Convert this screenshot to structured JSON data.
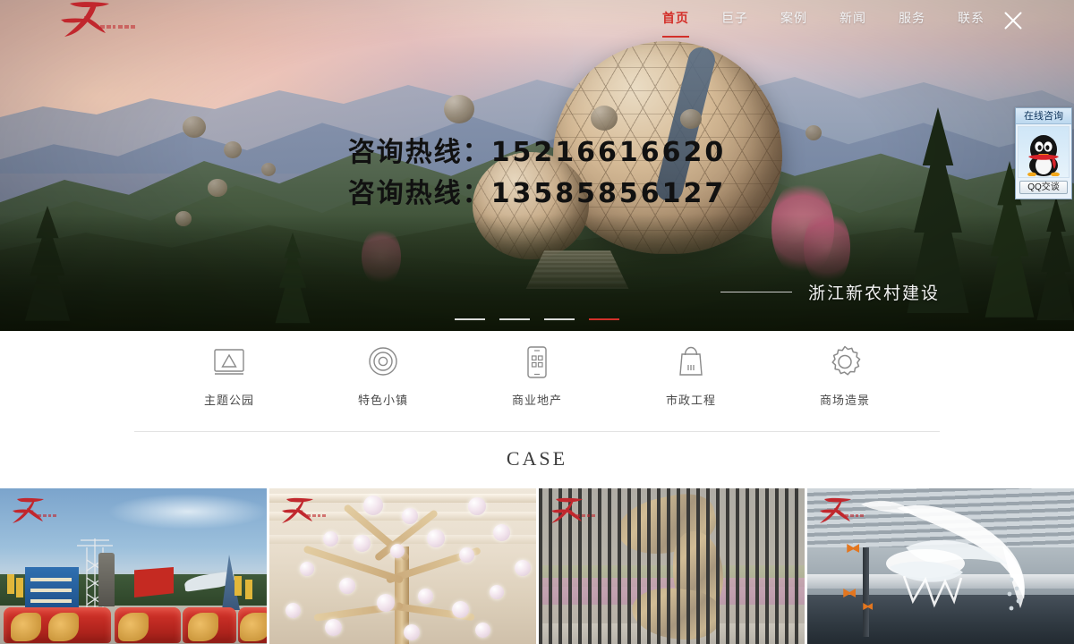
{
  "site": {
    "logo_alt": "巨子景观",
    "logo_color": "#c1272d"
  },
  "header": {
    "nav": [
      {
        "label": "首页",
        "active": true
      },
      {
        "label": "巨子",
        "active": false
      },
      {
        "label": "案例",
        "active": false
      },
      {
        "label": "新闻",
        "active": false
      },
      {
        "label": "服务",
        "active": false
      },
      {
        "label": "联系",
        "active": false
      }
    ],
    "close_icon": "close-icon",
    "accent_color": "#d3302a"
  },
  "hero": {
    "hotlines": [
      {
        "label": "咨询热线：",
        "number": "15216616620"
      },
      {
        "label": "咨询热线：",
        "number": "13585856127"
      }
    ],
    "caption": "浙江新农村建设",
    "slides": [
      {
        "active": false
      },
      {
        "active": false
      },
      {
        "active": false
      },
      {
        "active": true
      }
    ]
  },
  "qq_widget": {
    "title": "在线咨询",
    "button_label": "QQ交谈",
    "mascot": "qq-penguin-icon"
  },
  "services": {
    "items": [
      {
        "label": "主题公园",
        "icon": "theme-park-icon"
      },
      {
        "label": "特色小镇",
        "icon": "town-circle-icon"
      },
      {
        "label": "商业地产",
        "icon": "mobile-phone-icon"
      },
      {
        "label": "市政工程",
        "icon": "municipal-bag-icon"
      },
      {
        "label": "商场造景",
        "icon": "gear-icon"
      }
    ]
  },
  "case": {
    "title": "CASE",
    "cards": [
      {
        "name": "plaza-red-sculpture-case",
        "watermark": "巨子景观"
      },
      {
        "name": "mall-crystal-tree-case",
        "watermark": "巨子景观"
      },
      {
        "name": "bronze-abstract-sculpture-case",
        "watermark": "巨子景观"
      },
      {
        "name": "atrium-white-installation-case",
        "watermark": "巨子景观"
      }
    ]
  }
}
